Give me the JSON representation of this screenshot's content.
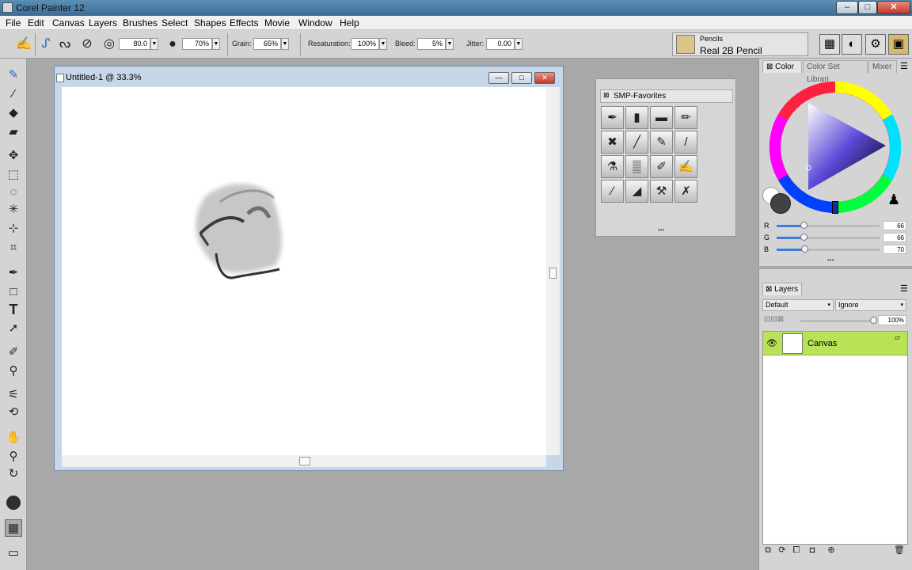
{
  "app": {
    "title": "Corel Painter 12"
  },
  "menu": [
    "File",
    "Edit",
    "Canvas",
    "Layers",
    "Brushes",
    "Select",
    "Shapes",
    "Effects",
    "Movie",
    "Window",
    "Help"
  ],
  "props": {
    "size": "80.0",
    "opacity": "70%",
    "grain_label": "Grain:",
    "grain": "65%",
    "resaturation_label": "Resaturation:",
    "resaturation": "100%",
    "bleed_label": "Bleed:",
    "bleed": "5%",
    "jitter_label": "Jitter:",
    "jitter": "0.00"
  },
  "brush_selector": {
    "category": "Pencils",
    "variant": "Real 2B Pencil"
  },
  "document": {
    "title": "Untitled-1 @ 33.3%"
  },
  "smp_palette": {
    "title": "SMP-Favorites",
    "brush_icons": [
      "pen-nib-icon",
      "round-brush-icon",
      "flat-brush-icon",
      "pencil-icon",
      "cross-brushes-icon",
      "fine-brush-icon",
      "pens-icon",
      "liner-icon",
      "dropper-brush-icon",
      "sponge-icon",
      "bristle-brush-icon",
      "marker-icon",
      "thin-pencil-icon",
      "palette-knife-icon",
      "eraser-brushes-icon",
      "smudge-icon"
    ]
  },
  "color_panel": {
    "tabs": [
      "Color",
      "Color Set Librari",
      "Mixer"
    ],
    "r_label": "R",
    "g_label": "G",
    "b_label": "B",
    "r": "66",
    "g": "66",
    "b": "70",
    "r_fraction": 0.26,
    "g_fraction": 0.26,
    "b_fraction": 0.27,
    "main_color": "#424246"
  },
  "layers_panel": {
    "title": "Layers",
    "composite_method": "Default",
    "composite_depth": "Ignore",
    "opacity": "100%",
    "layer_name": "Canvas",
    "layer_color": "#b9e356"
  }
}
